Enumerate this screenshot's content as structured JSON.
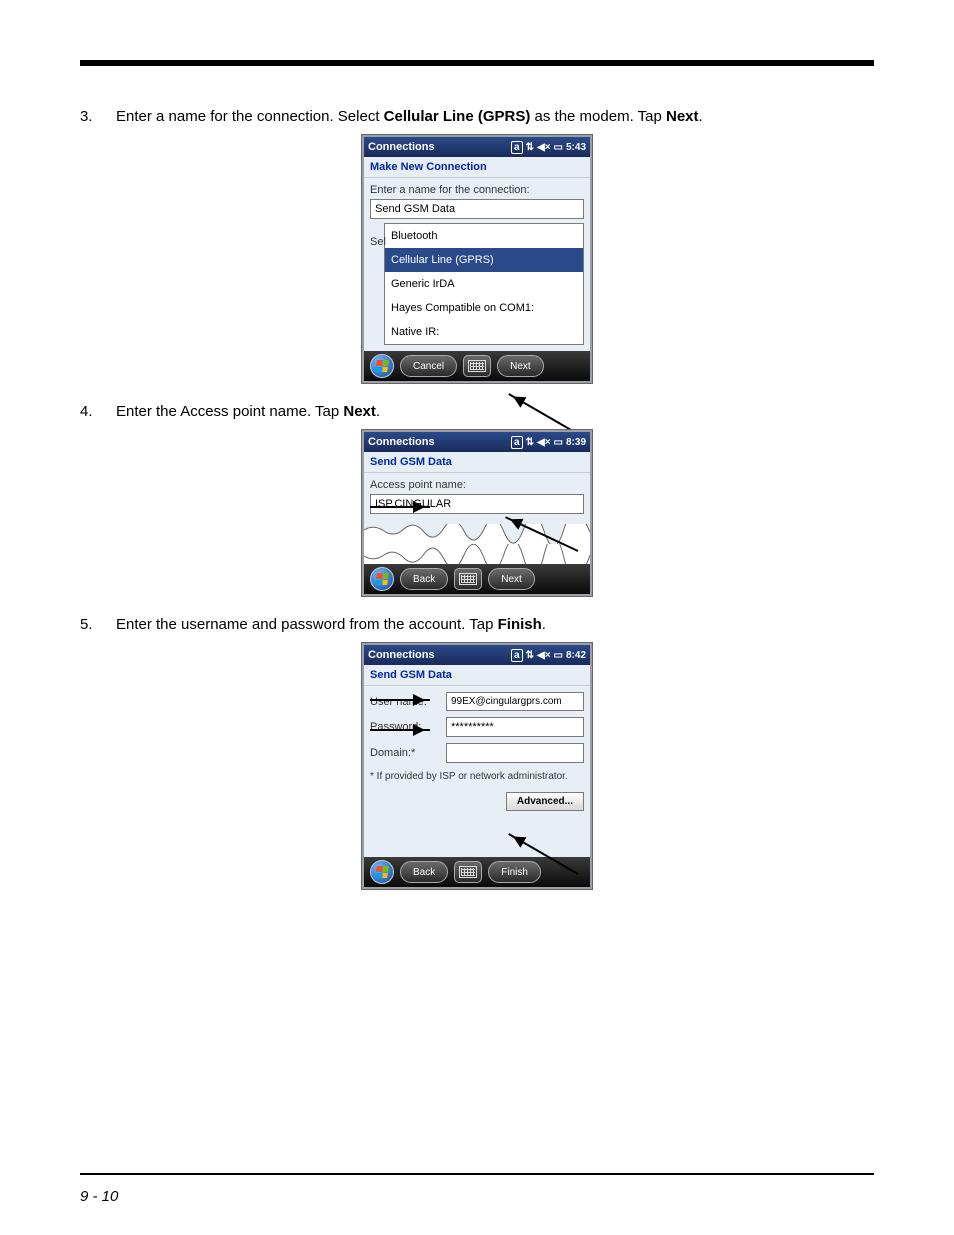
{
  "page_number": "9 - 10",
  "step3": {
    "num": "3.",
    "text_a": "Enter a name for the connection. Select ",
    "text_b": "Cellular Line (GPRS)",
    "text_c": " as the modem. Tap ",
    "text_d": "Next",
    "text_e": "."
  },
  "step4": {
    "num": "4.",
    "text_a": "Enter the Access point name. Tap ",
    "text_b": "Next",
    "text_c": "."
  },
  "step5": {
    "num": "5.",
    "text_a": "Enter the username and password from the account.  Tap ",
    "text_b": "Finish",
    "text_c": "."
  },
  "screen1": {
    "title": "Connections",
    "time": "5:43",
    "subtitle": "Make New Connection",
    "prompt": "Enter a name for the connection:",
    "name_value": "Send GSM Data",
    "sel_prefix": "Sel",
    "options": [
      "Bluetooth",
      "Cellular Line (GPRS)",
      "Generic IrDA",
      "Hayes Compatible on COM1:",
      "Native IR:"
    ],
    "cancel": "Cancel",
    "next": "Next"
  },
  "screen2": {
    "title": "Connections",
    "time": "8:39",
    "subtitle": "Send GSM Data",
    "prompt": "Access point name:",
    "value": "ISP.CINGULAR",
    "back": "Back",
    "next": "Next"
  },
  "screen3": {
    "title": "Connections",
    "time": "8:42",
    "subtitle": "Send GSM Data",
    "user_label": "User name:",
    "user_value": "99EX@cingulargprs.com",
    "pass_label": "Password:",
    "pass_value": "**********",
    "domain_label": "Domain:*",
    "domain_value": "",
    "note": "* If provided by ISP or network administrator.",
    "advanced": "Advanced...",
    "back": "Back",
    "finish": "Finish"
  },
  "icons": {
    "input_mode": "a",
    "signal": "⇅",
    "volume": "◀×",
    "battery": "▭"
  }
}
